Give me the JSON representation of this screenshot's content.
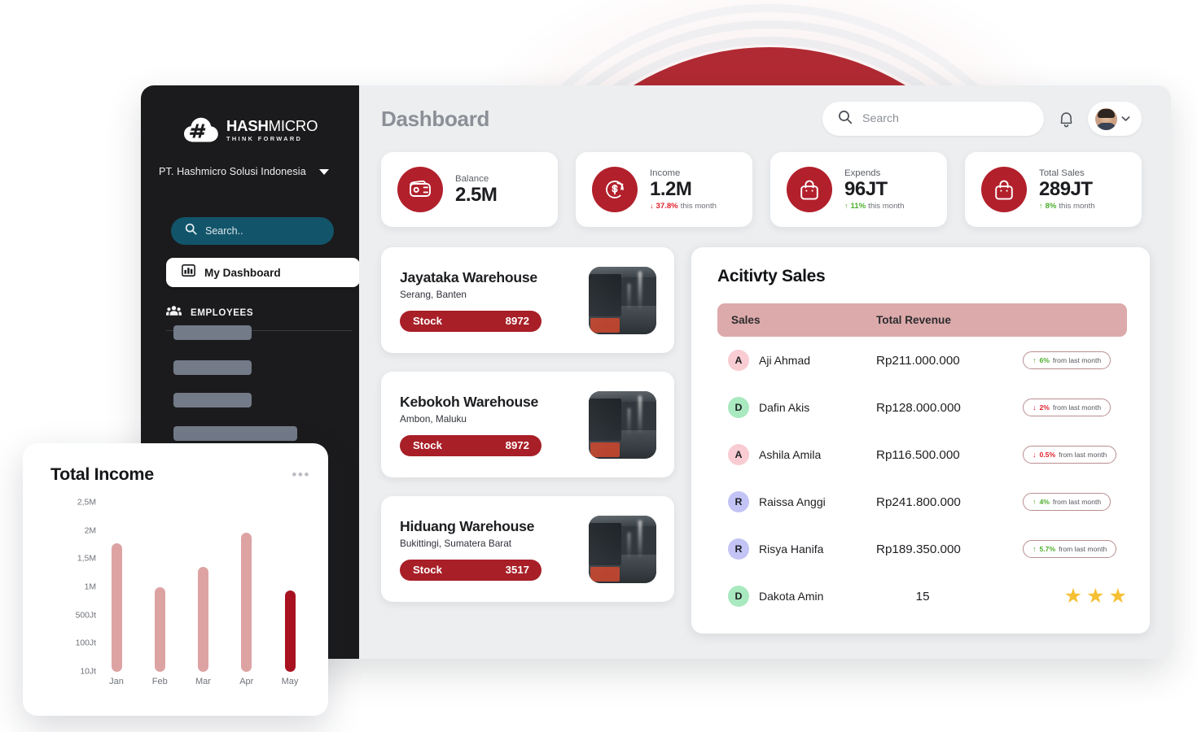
{
  "brand": {
    "logo_main": "HASH",
    "logo_main_thin": "MICRO",
    "logo_sub": "THINK FORWARD",
    "accent_red": "#b2202c",
    "accent_dark_red": "#a81f27",
    "teal": "#12556b"
  },
  "sidebar": {
    "company": "PT. Hashmicro Solusi Indonesia",
    "search_placeholder": "Search..",
    "nav_active": "My Dashboard",
    "section_label": "EMPLOYEES"
  },
  "header": {
    "title": "Dashboard",
    "search_placeholder": "Search"
  },
  "kpis": [
    {
      "label": "Balance",
      "value": "2.5M",
      "delta": "",
      "delta_suffix": "",
      "dir": "none"
    },
    {
      "label": "Income",
      "value": "1.2M",
      "delta": "37.8%",
      "delta_suffix": "this month",
      "dir": "down"
    },
    {
      "label": "Expends",
      "value": "96JT",
      "delta": "11%",
      "delta_suffix": "this month",
      "dir": "up"
    },
    {
      "label": "Total Sales",
      "value": "289JT",
      "delta": "8%",
      "delta_suffix": "this month",
      "dir": "up"
    }
  ],
  "warehouses": [
    {
      "name": "Jayataka Warehouse",
      "location": "Serang, Banten",
      "stock_label": "Stock",
      "stock": "8972"
    },
    {
      "name": "Kebokoh Warehouse",
      "location": "Ambon, Maluku",
      "stock_label": "Stock",
      "stock": "8972"
    },
    {
      "name": "Hiduang Warehouse",
      "location": "Bukittingi, Sumatera Barat",
      "stock_label": "Stock",
      "stock": "3517"
    }
  ],
  "activity_sales": {
    "title": "Acitivty Sales",
    "columns": {
      "sales": "Sales",
      "revenue": "Total Revenue"
    },
    "rows": [
      {
        "initial": "A",
        "avatar_color": "#f8ccd2",
        "name": "Aji Ahmad",
        "revenue": "Rp211.000.000",
        "delta": "6%",
        "delta_text": "from last month",
        "dir": "up",
        "stars": 0
      },
      {
        "initial": "D",
        "avatar_color": "#a9e9bf",
        "name": "Dafin Akis",
        "revenue": "Rp128.000.000",
        "delta": "2%",
        "delta_text": "from last month",
        "dir": "down",
        "stars": 0
      },
      {
        "initial": "A",
        "avatar_color": "#f8ccd2",
        "name": "Ashila Amila",
        "revenue": "Rp116.500.000",
        "delta": "0.5%",
        "delta_text": "from last month",
        "dir": "down",
        "stars": 0
      },
      {
        "initial": "R",
        "avatar_color": "#c3c4f5",
        "name": "Raissa Anggi",
        "revenue": "Rp241.800.000",
        "delta": "4%",
        "delta_text": "from last month",
        "dir": "up",
        "stars": 0
      },
      {
        "initial": "R",
        "avatar_color": "#c3c4f5",
        "name": "Risya Hanifa",
        "revenue": "Rp189.350.000",
        "delta": "5.7%",
        "delta_text": "from last month",
        "dir": "up",
        "stars": 0
      },
      {
        "initial": "D",
        "avatar_color": "#a9e9bf",
        "name": "Dakota Amin",
        "revenue": "15",
        "delta": "",
        "delta_text": "",
        "dir": "none",
        "stars": 3
      }
    ]
  },
  "income_card": {
    "title": "Total Income",
    "menu": "•••"
  },
  "chart_data": {
    "type": "bar",
    "title": "Total Income",
    "categories": [
      "Jan",
      "Feb",
      "Mar",
      "Apr",
      "May"
    ],
    "values": [
      1900000,
      1250000,
      1550000,
      2050000,
      1200000
    ],
    "value_labels": [
      "1,9M",
      "1,25M",
      "1,55M",
      "2,05M",
      "1,2M"
    ],
    "ytick_labels": [
      "2,5M",
      "2M",
      "1,5M",
      "1M",
      "500Jt",
      "100Jt",
      "10Jt"
    ],
    "ytick_positions": [
      1.0,
      0.8333,
      0.6667,
      0.5,
      0.3333,
      0.1667,
      0.0
    ],
    "ylim": [
      0,
      2500000
    ],
    "xlabel": "",
    "ylabel": "",
    "grid": false,
    "legend": false,
    "bar_colors": [
      "#dda3a3",
      "#dda3a3",
      "#dda3a3",
      "#dda3a3",
      "#a81220"
    ],
    "highlight_index": 4
  }
}
